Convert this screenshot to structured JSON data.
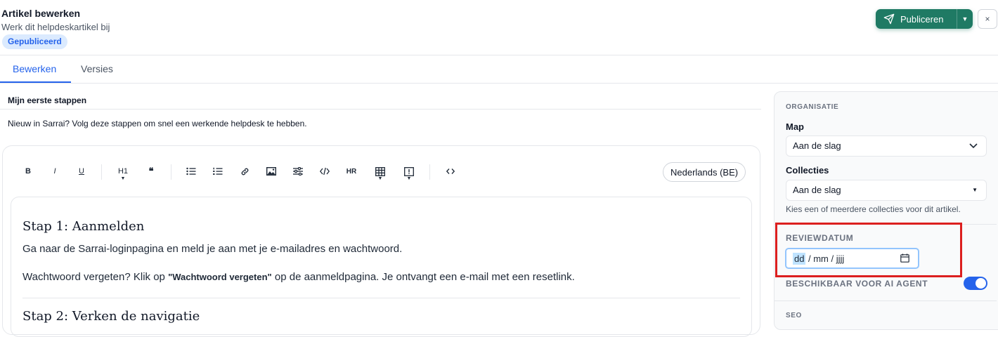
{
  "header": {
    "title": "Artikel bewerken",
    "subtitle": "Werk dit helpdeskartikel bij",
    "status_badge": "Gepubliceerd",
    "publish_label": "Publiceren",
    "close_label": "×"
  },
  "tabs": [
    {
      "label": "Bewerken",
      "active": true
    },
    {
      "label": "Versies",
      "active": false
    }
  ],
  "article": {
    "title": "Mijn eerste stappen",
    "summary": "Nieuw in Sarrai? Volg deze stappen om snel een werkende helpdesk te hebben."
  },
  "toolbar": {
    "bold": "B",
    "italic": "I",
    "underline": "U",
    "heading": "H1",
    "quote": "❝",
    "hr": "HR",
    "language": "Nederlands (BE)"
  },
  "content": {
    "step1_heading": "Stap 1: Aanmelden",
    "step1_para1": "Ga naar de Sarrai-loginpagina en meld je aan met je e-mailadres en wachtwoord.",
    "step1_para2_before": "Wachtwoord vergeten? Klik op ",
    "step1_para2_bold": "\"Wachtwoord vergeten\"",
    "step1_para2_after": " op de aanmeldpagina. Je ontvangt een e-mail met een resetlink.",
    "step2_heading": "Stap 2: Verken de navigatie"
  },
  "sidebar": {
    "section_organisation": "ORGANISATIE",
    "map_label": "Map",
    "map_value": "Aan de slag",
    "collections_label": "Collecties",
    "collections_value": "Aan de slag",
    "collections_hint": "Kies een of meerdere collecties voor dit artikel.",
    "review_label": "REVIEWDATUM",
    "review_date_dd": "dd",
    "review_date_rest": "/ mm / jjjj",
    "ai_agent_label": "BESCHIKBAAR VOOR AI AGENT",
    "ai_agent_enabled": true,
    "seo_label": "SEO"
  },
  "colors": {
    "accent": "#2563eb",
    "publish": "#1f7a64",
    "highlight": "#dc1f1f"
  }
}
